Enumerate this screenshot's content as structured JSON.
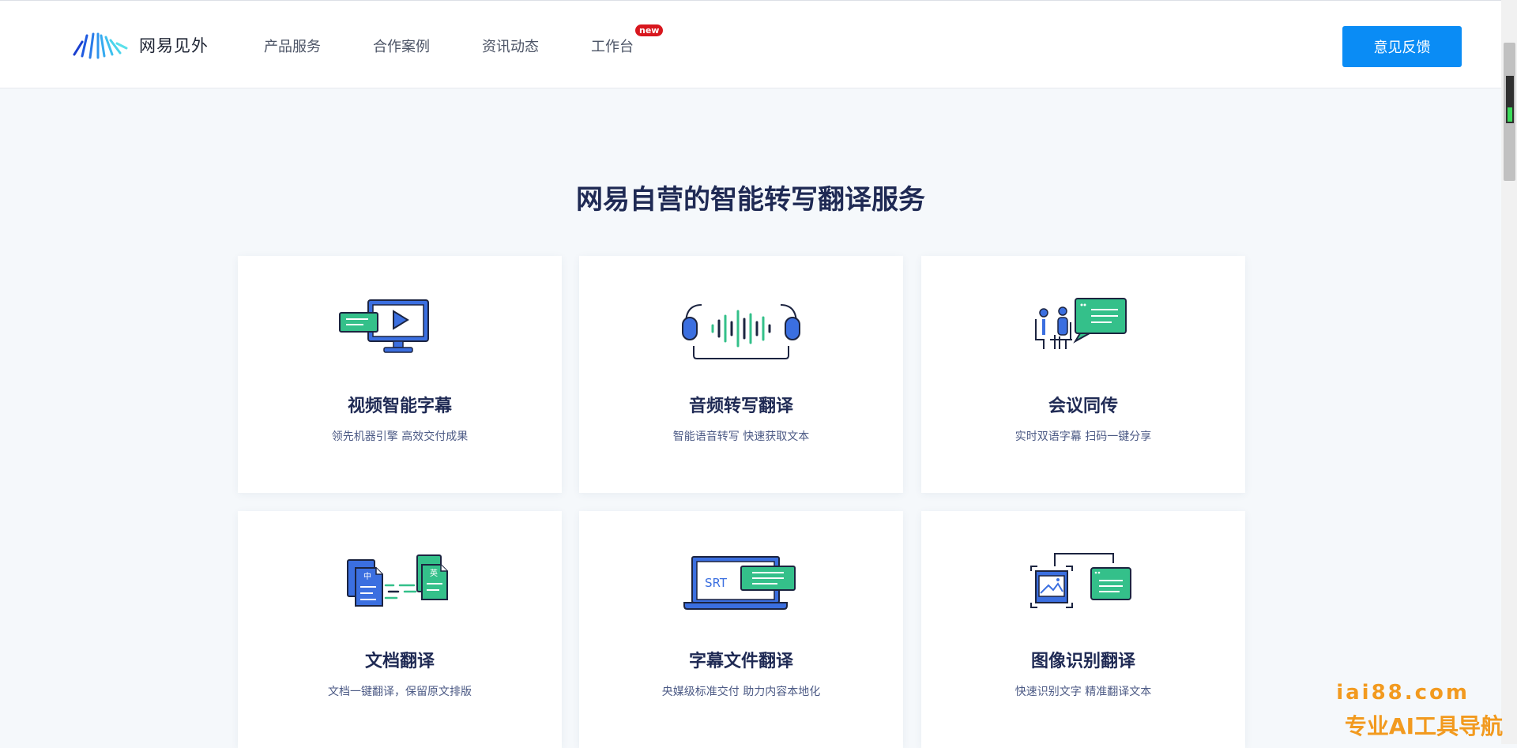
{
  "header": {
    "logo_text": "网易见外",
    "nav": [
      {
        "label": "产品服务"
      },
      {
        "label": "合作案例"
      },
      {
        "label": "资讯动态"
      },
      {
        "label": "工作台",
        "badge": "new"
      }
    ],
    "feedback_label": "意见反馈"
  },
  "main": {
    "title": "网易自营的智能转写翻译服务",
    "cards": [
      {
        "title": "视频智能字幕",
        "subtitle": "领先机器引擎 高效交付成果",
        "icon": "video-subtitle-icon"
      },
      {
        "title": "音频转写翻译",
        "subtitle": "智能语音转写 快速获取文本",
        "icon": "audio-transcription-icon"
      },
      {
        "title": "会议同传",
        "subtitle": "实时双语字幕 扫码一键分享",
        "icon": "meeting-interpretation-icon"
      },
      {
        "title": "文档翻译",
        "subtitle": "文档一键翻译，保留原文排版",
        "icon": "document-translation-icon",
        "icon_text_left": "中",
        "icon_text_right": "英"
      },
      {
        "title": "字幕文件翻译",
        "subtitle": "央媒级标准交付 助力内容本地化",
        "icon": "subtitle-file-icon",
        "icon_text": "SRT"
      },
      {
        "title": "图像识别翻译",
        "subtitle": "快速识别文字 精准翻译文本",
        "icon": "image-recognition-icon"
      }
    ]
  },
  "watermark": {
    "line1": "iai88.com",
    "line2": "专业AI工具导航"
  },
  "colors": {
    "accent_blue": "#0a8cf5",
    "icon_blue": "#3b6fe0",
    "icon_green": "#34c08a",
    "title_navy": "#1f2a54",
    "badge_red": "#d8171e",
    "watermark_orange": "#f29a1f"
  }
}
